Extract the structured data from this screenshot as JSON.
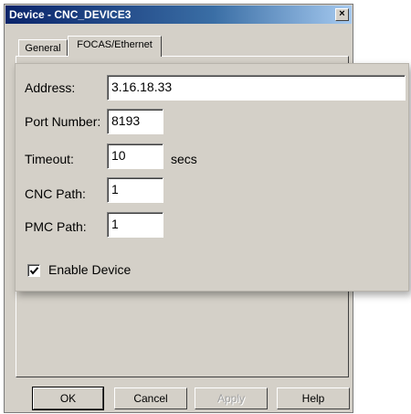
{
  "window": {
    "title": "Device - CNC_DEVICE3",
    "close_glyph": "×"
  },
  "tabs": [
    {
      "label": "General",
      "active": false
    },
    {
      "label": "FOCAS/Ethernet",
      "active": true
    }
  ],
  "form": {
    "address": {
      "label": "Address:",
      "value": "3.16.18.33"
    },
    "port": {
      "label": "Port Number:",
      "value": "8193"
    },
    "timeout": {
      "label": "Timeout:",
      "value": "10",
      "unit": "secs"
    },
    "cnc_path": {
      "label": "CNC Path:",
      "value": "1"
    },
    "pmc_path": {
      "label": "PMC Path:",
      "value": "1"
    },
    "enable_device": {
      "label": "Enable Device",
      "checked": true
    }
  },
  "buttons": {
    "ok": "OK",
    "cancel": "Cancel",
    "apply": "Apply",
    "help": "Help"
  }
}
